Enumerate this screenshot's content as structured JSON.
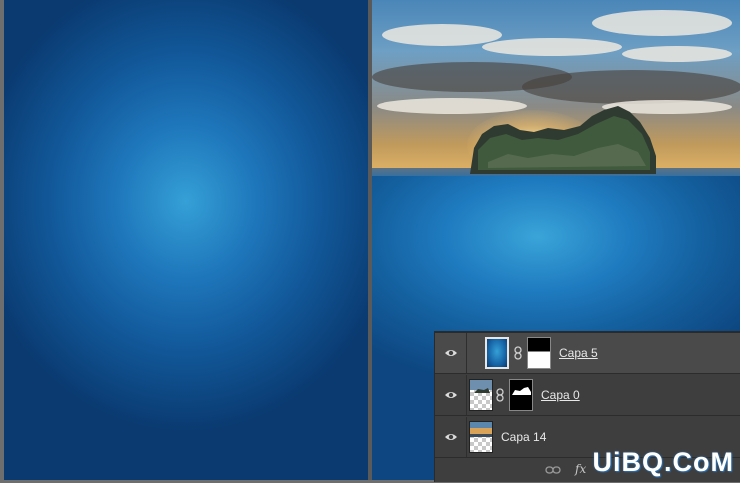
{
  "layers": [
    {
      "name": "Capa 5",
      "visible": true,
      "selected": true,
      "thumb": "blue-gradient",
      "mask": "black-top-white-bottom",
      "linked": true
    },
    {
      "name": "Capa 0",
      "visible": true,
      "selected": false,
      "thumb": "island-photo",
      "mask": "island-silhouette",
      "linked": true
    },
    {
      "name": "Capa 14",
      "visible": true,
      "selected": false,
      "thumb": "sunset-photo",
      "mask": "",
      "linked": false
    }
  ],
  "footer": {
    "fx_label": "fx",
    "icons": [
      "link-icon",
      "fx-icon"
    ]
  },
  "watermark": "UiBQ.CoM",
  "icons": {
    "visibility": "eye-icon",
    "link": "chain-icon"
  },
  "colors": {
    "sea_center": "#35a0d6",
    "sea_edge": "#0a3a70",
    "panel_bg": "#3e3e3e",
    "selected_row": "#4a4a4a"
  }
}
